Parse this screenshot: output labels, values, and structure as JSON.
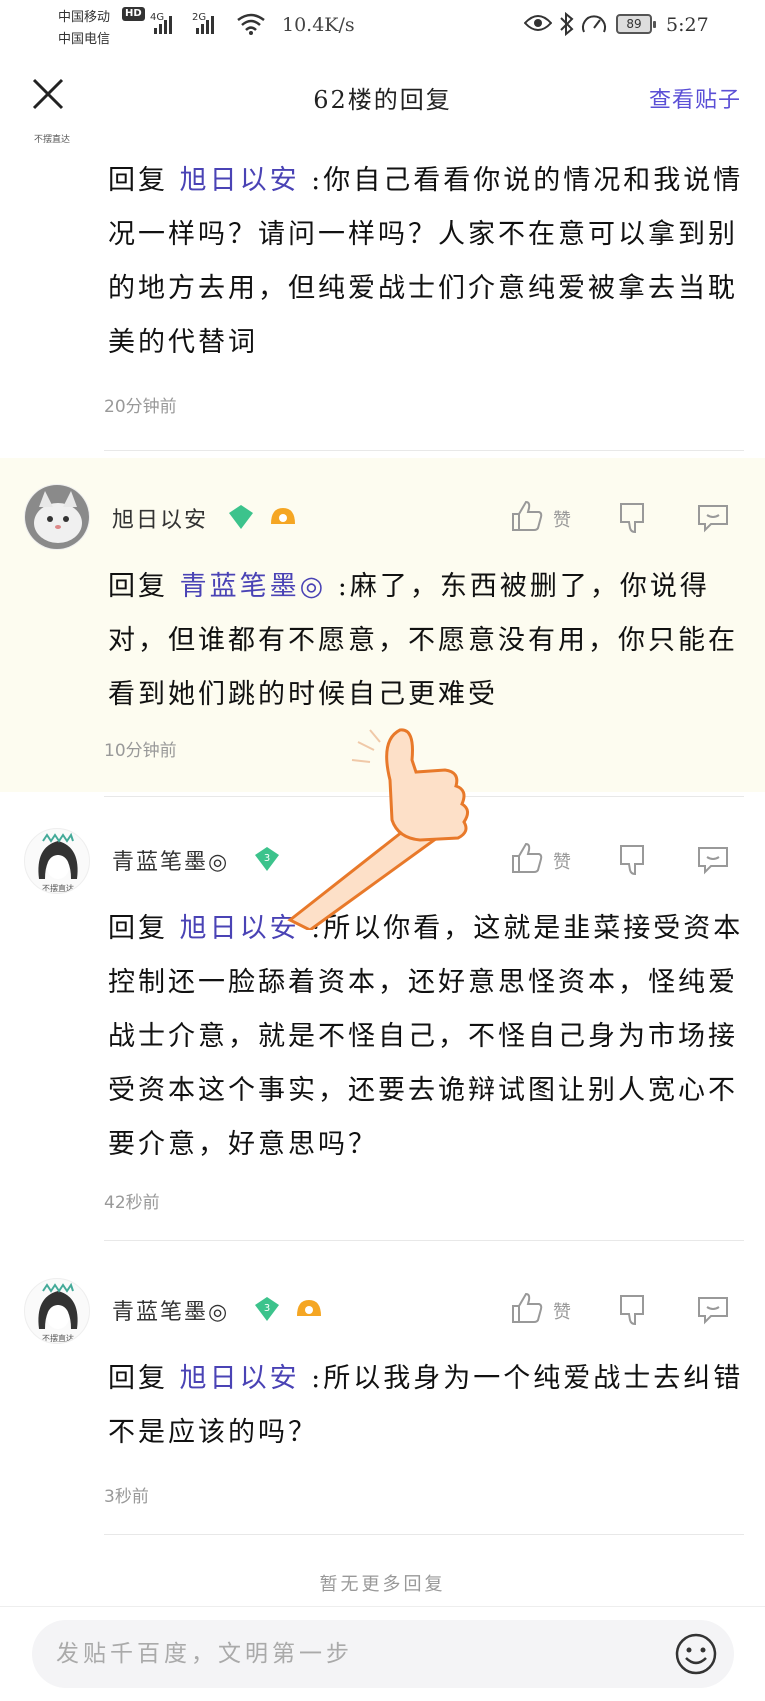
{
  "status_bar": {
    "carrier1": "中国移动",
    "hd": "HD",
    "carrier2": "中国电信",
    "net1": "4G",
    "net2": "2G",
    "speed": "10.4K/s",
    "battery": "89",
    "time": "5:27"
  },
  "header": {
    "title": "62楼的回复",
    "view_post": "查看贴子"
  },
  "replies": [
    {
      "prefix": "回复 ",
      "mention": "旭日以安",
      "text": " :你自己看看你说的情况和我说情况一样吗？请问一样吗？人家不在意可以拿到别的地方去用，但纯爱战士们介意纯爱被拿去当耽美的代替词",
      "time": "20分钟前"
    },
    {
      "username": "旭日以安",
      "level": "",
      "like": "赞",
      "prefix": "回复 ",
      "mention": "青蓝笔墨◎",
      "text": " :麻了，东西被删了，你说得对，但谁都有不愿意，不愿意没有用，你只能在看到她们跳的时候自己更难受",
      "time": "10分钟前"
    },
    {
      "username": "青蓝笔墨◎",
      "level": "3",
      "like": "赞",
      "prefix": "回复 ",
      "mention": "旭日以安",
      "text": " :所以你看，这就是韭菜接受资本控制还一脸舔着资本，还好意思怪资本，怪纯爱战士介意，就是不怪自己，不怪自己身为市场接受资本这个事实，还要去诡辩试图让别人宽心不要介意，好意思吗？",
      "time": "42秒前"
    },
    {
      "username": "青蓝笔墨◎",
      "level": "3",
      "like": "赞",
      "prefix": "回复 ",
      "mention": "旭日以安",
      "text": " :所以我身为一个纯爱战士去纠错不是应该的吗？",
      "time": "3秒前"
    }
  ],
  "footer": {
    "no_more": "暂无更多回复",
    "input_placeholder": "发贴千百度，文明第一步"
  },
  "colors": {
    "accent": "#5b4fd6",
    "mention": "#4a43b5",
    "highlight_bg": "#fdfcf0",
    "level_badge": "#3cc38c",
    "fan_badge": "#f5a623"
  }
}
